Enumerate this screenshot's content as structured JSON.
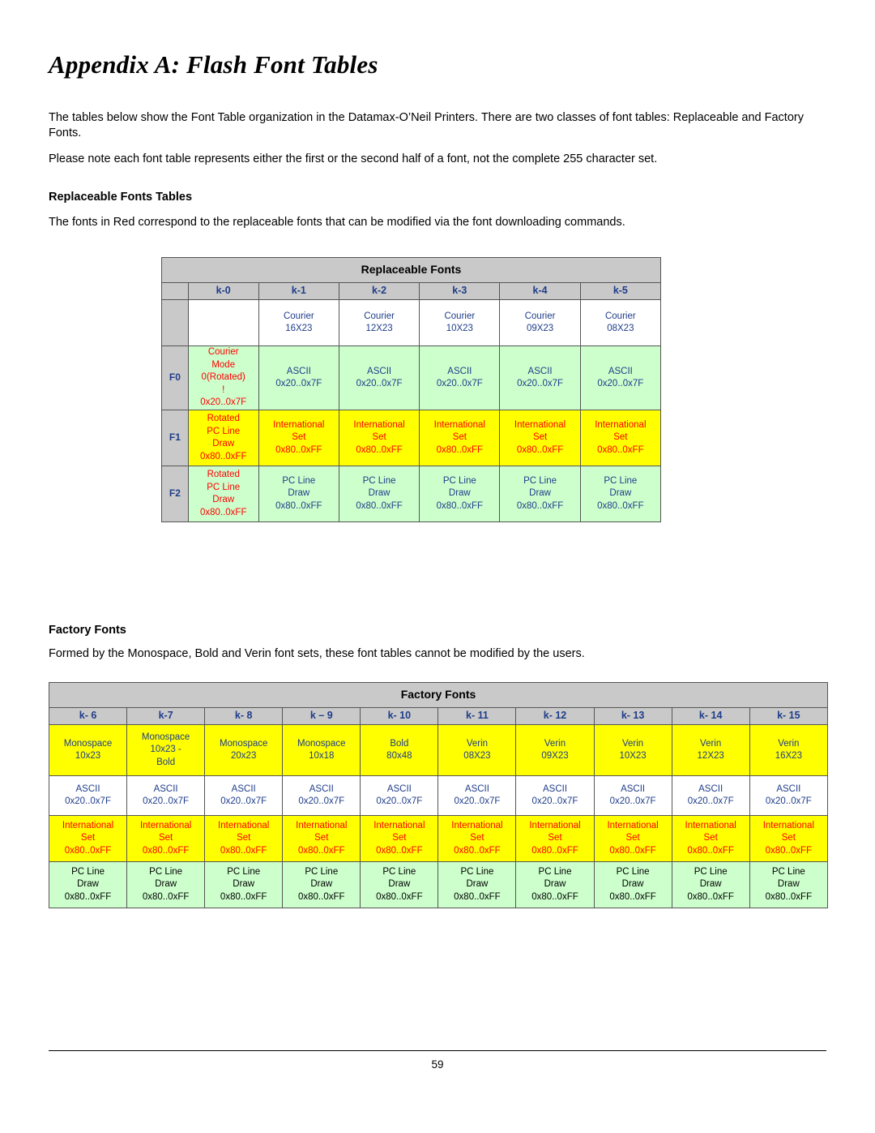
{
  "document": {
    "title": "Appendix A: Flash Font Tables",
    "intro1": "The tables below show the Font Table organization in the Datamax-O’Neil Printers. There are two classes of font tables: Replaceable and Factory Fonts.",
    "intro2": "Please note each font table represents either the first or the second half of a font, not the complete 255 character set.",
    "heading_replaceable": "Replaceable Fonts Tables",
    "note_replaceable": "The fonts in Red correspond to the replaceable fonts that can be modified via the font downloading commands.",
    "heading_factory": "Factory Fonts",
    "note_factory": "Formed by the Monospace, Bold and Verin font sets, these font tables cannot be modified by the users.",
    "page_number": "59"
  },
  "replaceable_table": {
    "caption": "Replaceable Fonts",
    "column_headers": [
      "k-0",
      "k-1",
      "k-2",
      "k-3",
      "k-4",
      "k-5"
    ],
    "row_labels": [
      "F0",
      "F1",
      "F2"
    ],
    "font_row": [
      "",
      "Courier\n16X23",
      "Courier\n12X23",
      "Courier\n10X23",
      "Courier\n09X23",
      "Courier\n08X23"
    ],
    "row_f0": [
      "Courier\nMode\n0(Rotated)\n!\n0x20..0x7F",
      "ASCII\n0x20..0x7F",
      "ASCII\n0x20..0x7F",
      "ASCII\n0x20..0x7F",
      "ASCII\n0x20..0x7F",
      "ASCII\n0x20..0x7F"
    ],
    "row_f1": [
      "Rotated\nPC Line\nDraw\n0x80..0xFF",
      "International\nSet\n0x80..0xFF",
      "International\nSet\n0x80..0xFF",
      "International\nSet\n0x80..0xFF",
      "International\nSet\n0x80..0xFF",
      "International\nSet\n0x80..0xFF"
    ],
    "row_f2": [
      "Rotated\nPC Line\nDraw\n0x80..0xFF",
      "PC Line\nDraw\n0x80..0xFF",
      "PC Line\nDraw\n0x80..0xFF",
      "PC Line\nDraw\n0x80..0xFF",
      "PC Line\nDraw\n0x80..0xFF",
      "PC Line\nDraw\n0x80..0xFF"
    ]
  },
  "factory_table": {
    "caption": "Factory Fonts",
    "column_headers": [
      "k- 6",
      "k-7",
      "k- 8",
      "k – 9",
      "k- 10",
      "k- 11",
      "k- 12",
      "k- 13",
      "k- 14",
      "k- 15"
    ],
    "font_row": [
      "Monospace\n10x23",
      "Monospace\n10x23 -\nBold",
      "Monospace\n20x23",
      "Monospace\n10x18",
      "Bold\n80x48",
      "Verin\n08X23",
      "Verin\n09X23",
      "Verin\n10X23",
      "Verin\n12X23",
      "Verin\n16X23"
    ],
    "ascii_row": [
      "ASCII\n0x20..0x7F",
      "ASCII\n0x20..0x7F",
      "ASCII\n0x20..0x7F",
      "ASCII\n0x20..0x7F",
      "ASCII\n0x20..0x7F",
      "ASCII\n0x20..0x7F",
      "ASCII\n0x20..0x7F",
      "ASCII\n0x20..0x7F",
      "ASCII\n0x20..0x7F",
      "ASCII\n0x20..0x7F"
    ],
    "international_row": [
      "International\nSet\n0x80..0xFF",
      "International\nSet\n0x80..0xFF",
      "International\nSet\n0x80..0xFF",
      "International\nSet\n0x80..0xFF",
      "International\nSet\n0x80..0xFF",
      "International\nSet\n0x80..0xFF",
      "International\nSet\n0x80..0xFF",
      "International\nSet\n0x80..0xFF",
      "International\nSet\n0x80..0xFF",
      "International\nSet\n0x80..0xFF"
    ],
    "pcline_row": [
      "PC Line\nDraw\n0x80..0xFF",
      "PC Line\nDraw\n0x80..0xFF",
      "PC Line\nDraw\n0x80..0xFF",
      "PC Line\nDraw\n0x80..0xFF",
      "PC Line\nDraw\n0x80..0xFF",
      "PC Line\nDraw\n0x80..0xFF",
      "PC Line\nDraw\n0x80..0xFF",
      "PC Line\nDraw\n0x80..0xFF",
      "PC Line\nDraw\n0x80..0xFF",
      "PC Line\nDraw\n0x80..0xFF"
    ]
  },
  "colors": {
    "header_gray": "#c9c9c9",
    "yellow": "#ffff00",
    "green": "#ccffcc",
    "red_text": "#ff0000",
    "navy_text": "#1f3d8a"
  }
}
